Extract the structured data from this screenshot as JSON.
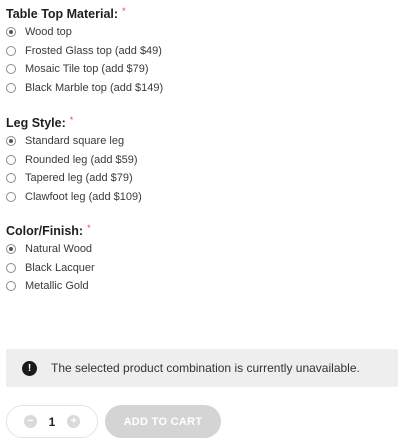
{
  "groups": [
    {
      "title": "Table Top Material:",
      "required_mark": "*",
      "options": [
        {
          "label": "Wood top",
          "checked": true
        },
        {
          "label": "Frosted Glass top (add $49)",
          "checked": false
        },
        {
          "label": "Mosaic Tile top (add $79)",
          "checked": false
        },
        {
          "label": "Black Marble top (add $149)",
          "checked": false
        }
      ]
    },
    {
      "title": "Leg Style:",
      "required_mark": "*",
      "options": [
        {
          "label": "Standard square leg",
          "checked": true
        },
        {
          "label": "Rounded leg (add $59)",
          "checked": false
        },
        {
          "label": "Tapered leg (add $79)",
          "checked": false
        },
        {
          "label": "Clawfoot leg (add $109)",
          "checked": false
        }
      ]
    },
    {
      "title": "Color/Finish:",
      "required_mark": "*",
      "options": [
        {
          "label": "Natural Wood",
          "checked": true
        },
        {
          "label": "Black Lacquer",
          "checked": false
        },
        {
          "label": "Metallic Gold",
          "checked": false
        }
      ]
    }
  ],
  "alert": {
    "icon": "exclamation-icon",
    "icon_glyph": "!",
    "message": "The selected product combination is currently unavailable."
  },
  "quantity": {
    "value": "1",
    "decrement_glyph": "−",
    "increment_glyph": "+"
  },
  "add_to_cart": {
    "label": "ADD TO CART",
    "disabled": true
  },
  "colors": {
    "required_mark": "#e04a4a",
    "alert_background": "#eeeeee",
    "disabled_button": "#d4d4d4"
  }
}
